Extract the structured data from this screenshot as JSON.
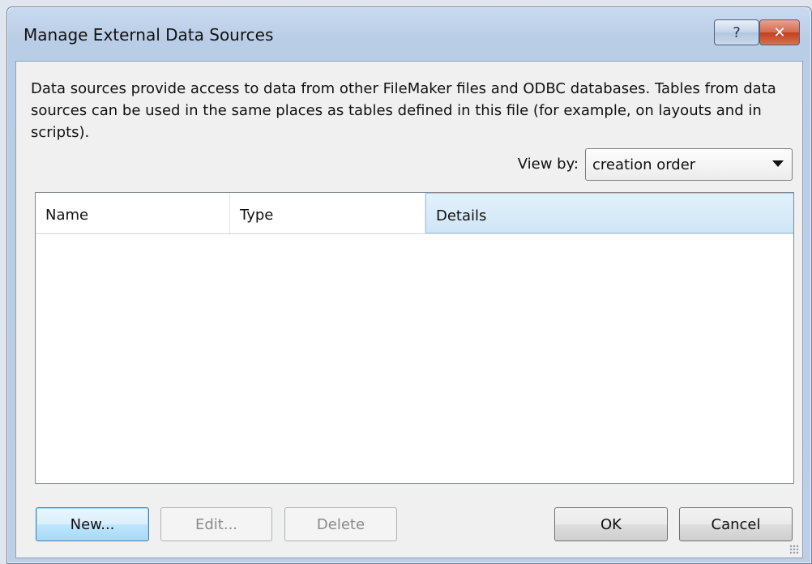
{
  "window": {
    "title": "Manage External Data Sources",
    "help_label": "?",
    "close_label": "✕"
  },
  "description": "Data sources provide access to data from other FileMaker files and ODBC databases. Tables from data sources can be used in the same places as tables defined in this file (for example, on layouts and in scripts).",
  "view_by": {
    "label": "View by:",
    "value": "creation order"
  },
  "list": {
    "columns": [
      "Name",
      "Type",
      "Details"
    ],
    "selected_column": "Details",
    "rows": []
  },
  "buttons": {
    "new": "New...",
    "edit": "Edit...",
    "delete": "Delete",
    "ok": "OK",
    "cancel": "Cancel"
  },
  "icons": {
    "help": "question-mark-icon",
    "close": "close-x-icon",
    "dropdown": "chevron-down-icon",
    "resize": "resize-grip-icon"
  },
  "colors": {
    "selected_header": "#cfe6f7",
    "default_button_border": "#3c7fb1",
    "close_button": "#c2401f"
  }
}
